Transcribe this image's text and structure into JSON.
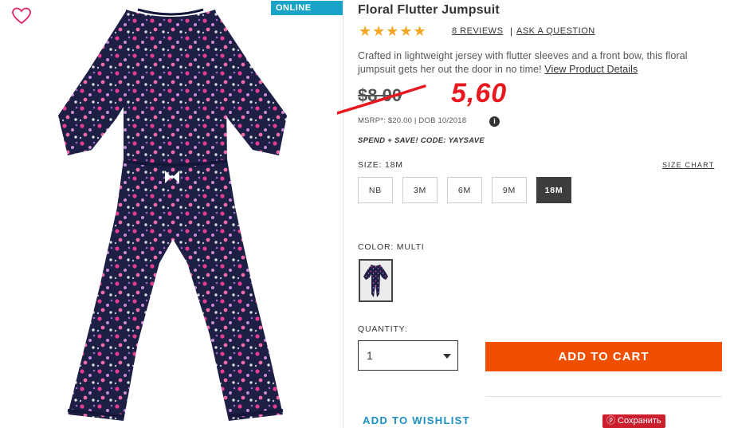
{
  "badge": {
    "online_only": "ONLINE ONLY"
  },
  "product": {
    "title": "Floral Flutter Jumpsuit",
    "stars": "★★★★★",
    "rating": 5,
    "reviews_link": "8 REVIEWS",
    "separator": "|",
    "ask_question": "ASK A QUESTION",
    "description": "Crafted in lightweight jersey with flutter sleeves and a front bow, this floral jumpsuit gets her out the door in no time! ",
    "view_details": "View Product Details",
    "old_price": "$8.00",
    "new_price": "5,60",
    "msrp": "MSRP*: $20.00 | DOB 10/2018",
    "info": "i",
    "promo": "SPEND + SAVE! CODE: YAYSAVE"
  },
  "size": {
    "label": "SIZE: 18M",
    "chart_link": "SIZE CHART",
    "options": [
      "NB",
      "3M",
      "6M",
      "9M",
      "18M"
    ],
    "selected": "18M"
  },
  "color": {
    "label": "COLOR: MULTI"
  },
  "quantity": {
    "label": "QUANTITY:",
    "value": "1"
  },
  "actions": {
    "add_to_cart": "ADD TO CART",
    "add_to_wishlist": "ADD TO WISHLIST",
    "save_pinterest": "ⓟ Сохранить"
  },
  "colors": {
    "accent_orange": "#f04f00",
    "price_red": "#e8181e",
    "star_gold": "#f5a623",
    "link_blue": "#1a8fc1",
    "badge_blue": "#1aa3c8",
    "print_navy": "#1d1f45",
    "print_pink": "#e43d8f"
  }
}
